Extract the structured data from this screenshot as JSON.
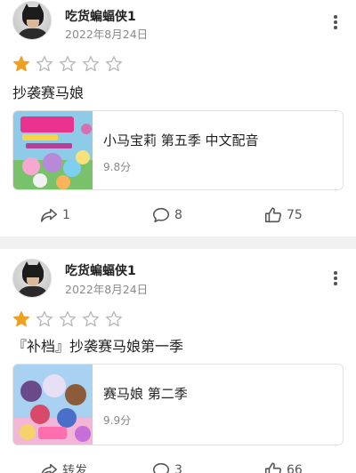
{
  "posts": [
    {
      "username": "吃货蝙蝠侠1",
      "date": "2022年8月24日",
      "rating": 1,
      "review": "抄袭赛马娘",
      "card": {
        "title": "小马宝莉 第五季 中文配音",
        "score": "9.8分"
      },
      "actions": {
        "share": "1",
        "comment": "8",
        "like": "75"
      }
    },
    {
      "username": "吃货蝙蝠侠1",
      "date": "2022年8月24日",
      "rating": 1,
      "review": "『补档』抄袭赛马娘第一季",
      "card": {
        "title": "赛马娘 第二季",
        "score": "9.9分"
      },
      "actions": {
        "share": "转发",
        "comment": "3",
        "like": "66"
      }
    }
  ],
  "colors": {
    "star_filled": "#f0a020",
    "star_empty": "#b8b8b8",
    "divider": "#f1f1f1"
  },
  "icons": [
    "more-icon",
    "star-icon",
    "share-icon",
    "comment-icon",
    "like-icon"
  ]
}
